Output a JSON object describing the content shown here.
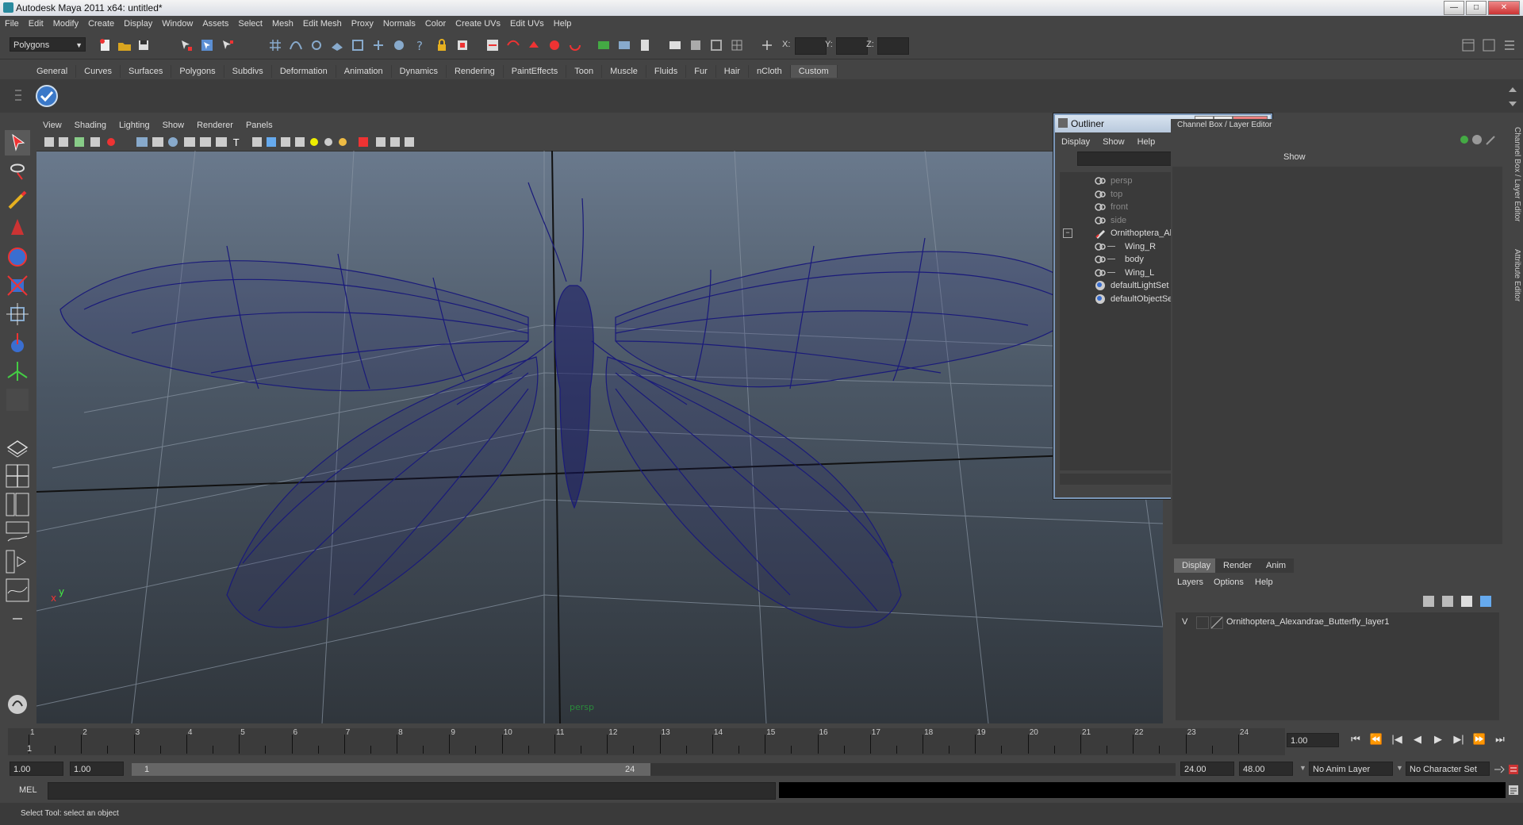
{
  "window": {
    "title": "Autodesk Maya 2011 x64: untitled*",
    "min": "—",
    "max": "□",
    "close": "✕"
  },
  "menubar": [
    "File",
    "Edit",
    "Modify",
    "Create",
    "Display",
    "Window",
    "Assets",
    "Select",
    "Mesh",
    "Edit Mesh",
    "Proxy",
    "Normals",
    "Color",
    "Create UVs",
    "Edit UVs",
    "Help"
  ],
  "statusline": {
    "mode": "Polygons",
    "x_label": "X:",
    "y_label": "Y:",
    "z_label": "Z:"
  },
  "shelf_tabs": [
    "General",
    "Curves",
    "Surfaces",
    "Polygons",
    "Subdivs",
    "Deformation",
    "Animation",
    "Dynamics",
    "Rendering",
    "PaintEffects",
    "Toon",
    "Muscle",
    "Fluids",
    "Fur",
    "Hair",
    "nCloth",
    "Custom"
  ],
  "shelf_active": "Custom",
  "viewport": {
    "menu": [
      "View",
      "Shading",
      "Lighting",
      "Show",
      "Renderer",
      "Panels"
    ],
    "camera_label": "persp",
    "axis_x": "x",
    "axis_y": "y",
    "wire_color": "#1a1a7a"
  },
  "outliner": {
    "title": "Outliner",
    "menu": [
      "Display",
      "Show",
      "Help"
    ],
    "items": [
      {
        "label": "persp",
        "dim": true,
        "icon": "camera-icon",
        "indent": 0
      },
      {
        "label": "top",
        "dim": true,
        "icon": "camera-icon",
        "indent": 0
      },
      {
        "label": "front",
        "dim": true,
        "icon": "camera-icon",
        "indent": 0
      },
      {
        "label": "side",
        "dim": true,
        "icon": "camera-icon",
        "indent": 0
      },
      {
        "label": "Ornithoptera_Alexandrae_Butterfl",
        "dim": false,
        "icon": "group-icon",
        "indent": 0,
        "expanded": true
      },
      {
        "label": "Wing_R",
        "dim": false,
        "icon": "mesh-icon",
        "indent": 1
      },
      {
        "label": "body",
        "dim": false,
        "icon": "mesh-icon",
        "indent": 1
      },
      {
        "label": "Wing_L",
        "dim": false,
        "icon": "mesh-icon",
        "indent": 1
      },
      {
        "label": "defaultLightSet",
        "dim": false,
        "icon": "set-icon",
        "indent": 0
      },
      {
        "label": "defaultObjectSet",
        "dim": false,
        "icon": "set-icon",
        "indent": 0
      }
    ]
  },
  "channelbox": {
    "title": "Channel Box / Layer Editor",
    "show": "Show"
  },
  "sidetabs": [
    "Channel Box / Layer Editor",
    "Attribute Editor"
  ],
  "layereditor": {
    "tabs": [
      "Display",
      "Render",
      "Anim"
    ],
    "active_tab": "Display",
    "menu": [
      "Layers",
      "Options",
      "Help"
    ],
    "layers": [
      {
        "visible": "V",
        "name": "Ornithoptera_Alexandrae_Butterfly_layer1"
      }
    ]
  },
  "timeslider": {
    "ticks": [
      "1",
      "2",
      "3",
      "4",
      "5",
      "6",
      "7",
      "8",
      "9",
      "10",
      "11",
      "12",
      "13",
      "14",
      "15",
      "16",
      "17",
      "18",
      "19",
      "20",
      "21",
      "22",
      "23",
      "24"
    ],
    "current": "1",
    "current_frame": "1.00"
  },
  "playback": [
    "⏮",
    "⏪",
    "|◀",
    "◀",
    "▶",
    "▶|",
    "⏩",
    "⏭"
  ],
  "range": {
    "start": "1.00",
    "playback_start": "1.00",
    "slider_start": "1",
    "slider_end": "24",
    "playback_end": "24.00",
    "end": "48.00",
    "anim_layer": "No Anim Layer",
    "char_set": "No Character Set"
  },
  "cmdline": {
    "label": "MEL"
  },
  "helpline": {
    "text": "Select Tool: select an object"
  }
}
